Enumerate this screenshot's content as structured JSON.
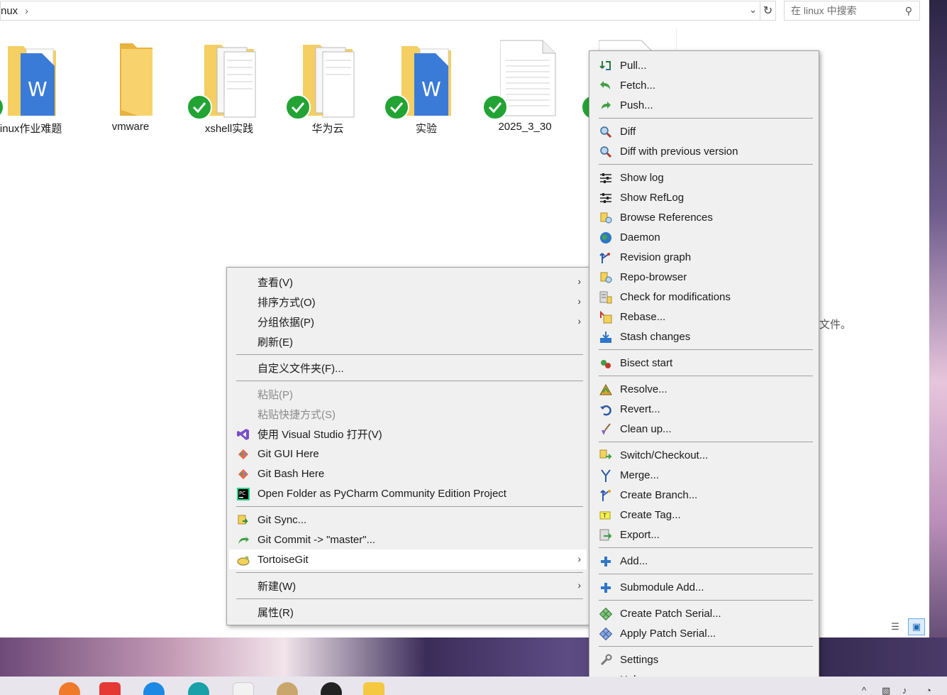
{
  "explorer": {
    "address": {
      "path": "nux",
      "chevron": "›"
    },
    "search": {
      "placeholder": "在 linux 中搜索"
    },
    "files": [
      {
        "name": "linux作业难题",
        "type": "folder-doc",
        "synced": true
      },
      {
        "name": "vmware",
        "type": "folder",
        "synced": false
      },
      {
        "name": "xshell实践",
        "type": "folder-pages",
        "synced": true
      },
      {
        "name": "华为云",
        "type": "folder-pages",
        "synced": true
      },
      {
        "name": "实验",
        "type": "folder-doc",
        "synced": true
      },
      {
        "name": "2025_3_30",
        "type": "file",
        "synced": true
      }
    ],
    "empty_message": "文件。"
  },
  "context_menu": {
    "items": [
      {
        "label": "查看(V)",
        "submenu": true
      },
      {
        "label": "排序方式(O)",
        "submenu": true
      },
      {
        "label": "分组依据(P)",
        "submenu": true
      },
      {
        "label": "刷新(E)"
      },
      {
        "label": "自定义文件夹(F)..."
      },
      {
        "label": "粘贴(P)",
        "disabled": true
      },
      {
        "label": "粘贴快捷方式(S)",
        "disabled": true
      },
      {
        "label": "使用 Visual Studio 打开(V)",
        "icon": "visual-studio-icon"
      },
      {
        "label": "Git GUI Here",
        "icon": "git-icon"
      },
      {
        "label": "Git Bash Here",
        "icon": "git-icon"
      },
      {
        "label": "Open Folder as PyCharm Community Edition Project",
        "icon": "pycharm-icon"
      },
      {
        "label": "Git Sync...",
        "icon": "sync-icon"
      },
      {
        "label": "Git Commit -> \"master\"...",
        "icon": "commit-icon"
      },
      {
        "label": "TortoiseGit",
        "icon": "tortoise-icon",
        "submenu": true,
        "highlighted": true
      },
      {
        "label": "新建(W)",
        "submenu": true
      },
      {
        "label": "属性(R)"
      }
    ]
  },
  "tortoisegit_menu": {
    "items": [
      {
        "label": "Pull...",
        "icon": "pull-icon"
      },
      {
        "label": "Fetch...",
        "icon": "fetch-icon"
      },
      {
        "label": "Push...",
        "icon": "push-icon"
      },
      {
        "label": "Diff",
        "icon": "diff-icon"
      },
      {
        "label": "Diff with previous version",
        "icon": "diff-icon"
      },
      {
        "label": "Show log",
        "icon": "log-icon"
      },
      {
        "label": "Show RefLog",
        "icon": "log-icon"
      },
      {
        "label": "Browse References",
        "icon": "references-icon"
      },
      {
        "label": "Daemon",
        "icon": "globe-icon"
      },
      {
        "label": "Revision graph",
        "icon": "graph-icon"
      },
      {
        "label": "Repo-browser",
        "icon": "repo-browser-icon"
      },
      {
        "label": "Check for modifications",
        "icon": "modifications-icon"
      },
      {
        "label": "Rebase...",
        "icon": "rebase-icon"
      },
      {
        "label": "Stash changes",
        "icon": "stash-icon"
      },
      {
        "label": "Bisect start",
        "icon": "bisect-icon"
      },
      {
        "label": "Resolve...",
        "icon": "resolve-icon"
      },
      {
        "label": "Revert...",
        "icon": "revert-icon"
      },
      {
        "label": "Clean up...",
        "icon": "cleanup-icon"
      },
      {
        "label": "Switch/Checkout...",
        "icon": "switch-icon"
      },
      {
        "label": "Merge...",
        "icon": "merge-icon"
      },
      {
        "label": "Create Branch...",
        "icon": "branch-icon"
      },
      {
        "label": "Create Tag...",
        "icon": "tag-icon"
      },
      {
        "label": "Export...",
        "icon": "export-icon"
      },
      {
        "label": "Add...",
        "icon": "add-icon"
      },
      {
        "label": "Submodule Add...",
        "icon": "add-icon"
      },
      {
        "label": "Create Patch Serial...",
        "icon": "patch-icon"
      },
      {
        "label": "Apply Patch Serial...",
        "icon": "patch-icon"
      },
      {
        "label": "Settings",
        "icon": "settings-icon"
      },
      {
        "label": "Help",
        "icon": "help-icon"
      }
    ]
  },
  "colors": {
    "accent": "#1d6ab8",
    "synced": "#22a334",
    "menu_bg": "#f0f0f0"
  }
}
